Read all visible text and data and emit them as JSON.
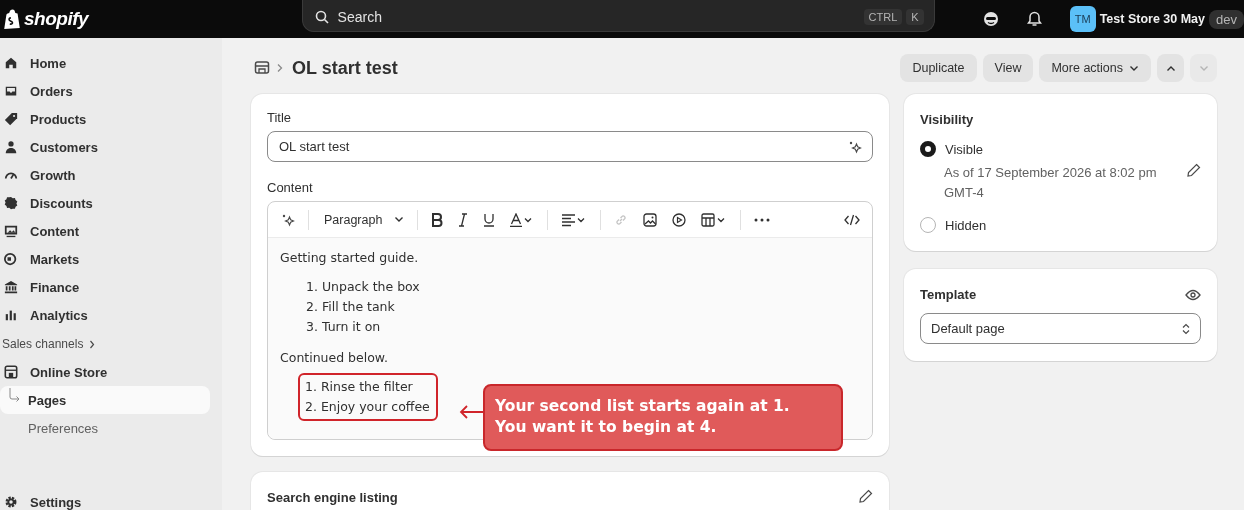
{
  "topbar": {
    "logo": "shopify",
    "search": {
      "placeholder": "Search",
      "keys": [
        "CTRL",
        "K"
      ]
    },
    "avatar": "TM",
    "store": "Test Store 30 May",
    "badge": "dev"
  },
  "sidebar": {
    "items": [
      {
        "label": "Home",
        "selected": false
      },
      {
        "label": "Orders",
        "selected": false
      },
      {
        "label": "Products",
        "selected": false
      },
      {
        "label": "Customers",
        "selected": false
      },
      {
        "label": "Growth",
        "selected": false
      },
      {
        "label": "Discounts",
        "selected": false
      },
      {
        "label": "Content",
        "selected": false
      },
      {
        "label": "Markets",
        "selected": false
      },
      {
        "label": "Finance",
        "selected": false
      },
      {
        "label": "Analytics",
        "selected": false
      }
    ],
    "section": {
      "label": "Sales channels",
      "expandable": true
    },
    "channel": {
      "label": "Online Store",
      "children": [
        {
          "label": "Pages",
          "selected": true
        },
        {
          "label": "Preferences",
          "selected": false
        }
      ]
    },
    "settings": "Settings"
  },
  "page": {
    "title": "OL start test",
    "actions": [
      {
        "label": "Duplicate",
        "kind": "plain"
      },
      {
        "label": "View",
        "kind": "plain"
      },
      {
        "label": "More actions",
        "kind": "menu"
      }
    ],
    "prev_disabled": false,
    "next_disabled": true
  },
  "editor_card": {
    "title_label": "Title",
    "title_value": "OL start test",
    "content_label": "Content",
    "block_style": "Paragraph",
    "blocks": [
      {
        "kind": "paragraph",
        "text": "Getting started guide."
      },
      {
        "kind": "list",
        "annotated": false,
        "items": [
          "1. Unpack the box",
          "2. Fill the tank",
          "3. Turn it on"
        ]
      },
      {
        "kind": "paragraph",
        "text": "Continued below."
      },
      {
        "kind": "list",
        "annotated": true,
        "items": [
          "1. Rinse the filter",
          "2. Enjoy your coffee"
        ]
      }
    ],
    "annotation": [
      "Your second list starts again at 1.",
      "You want it to begin at 4."
    ]
  },
  "seo_card": {
    "title": "Search engine listing"
  },
  "visibility": {
    "title": "Visibility",
    "options": [
      {
        "label": "Visible",
        "selected": true,
        "note": "As of 17 September 2026 at 8:02 pm GMT-4"
      },
      {
        "label": "Hidden",
        "selected": false
      }
    ]
  },
  "template": {
    "title": "Template",
    "value": "Default page"
  }
}
